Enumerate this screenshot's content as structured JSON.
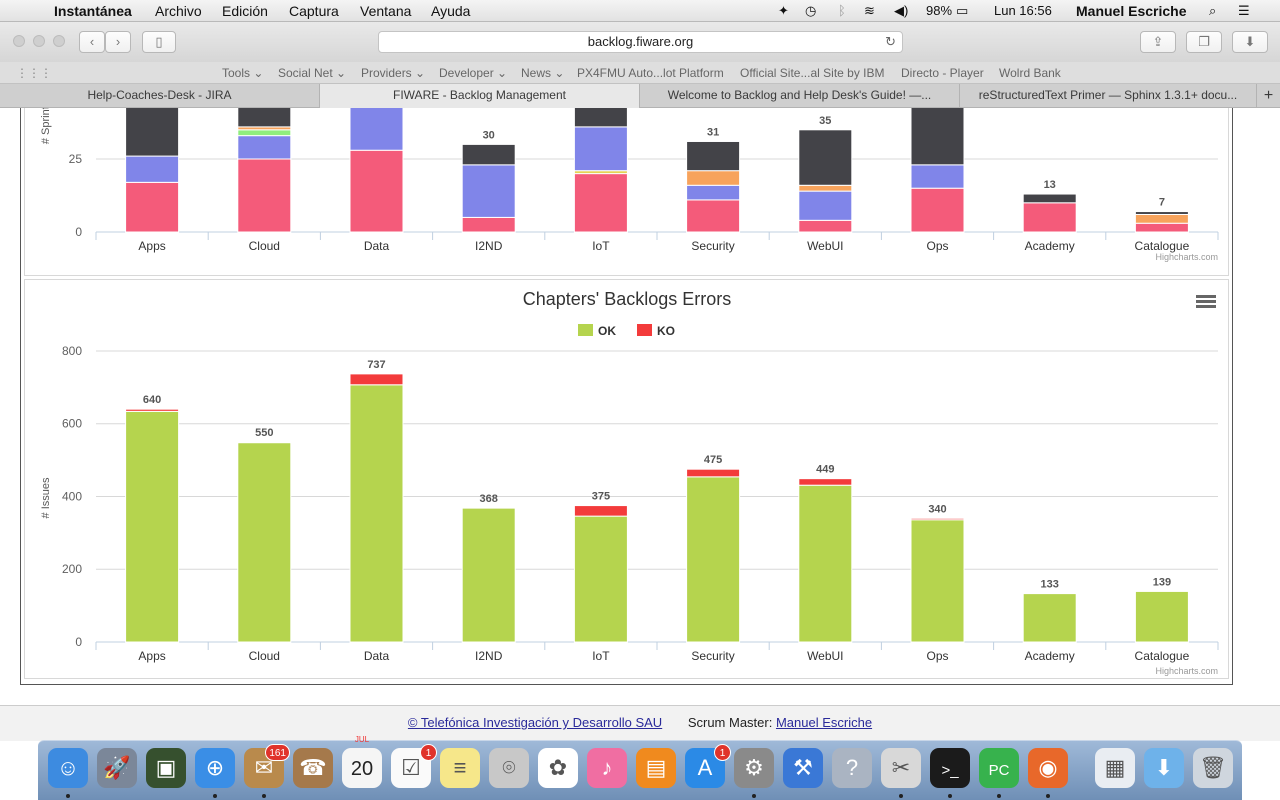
{
  "menubar": {
    "app": "Instantánea",
    "items": [
      "Archivo",
      "Edición",
      "Captura",
      "Ventana",
      "Ayuda"
    ],
    "battery": "98%",
    "clock": "Lun 16:56",
    "user": "Manuel Escriche"
  },
  "browser": {
    "url": "backlog.fiware.org",
    "favorites": [
      "Tools",
      "Social Net",
      "Providers",
      "Developer",
      "News",
      "PX4FMU Auto...lot Platform",
      "Official Site...al Site by IBM",
      "Directo - Player",
      "Wolrd Bank"
    ],
    "tabs": [
      "Help-Coaches-Desk - JIRA",
      "FIWARE - Backlog Management",
      "Welcome to Backlog and Help Desk's Guide! —...",
      "reStructuredText Primer — Sphinx 1.3.1+ docu..."
    ],
    "active_tab": 1
  },
  "colors": {
    "dark": "#434348",
    "blue": "#8085e9",
    "pink": "#f45b7a",
    "orange": "#f7a35c",
    "green": "#90ed7d",
    "lime": "#b5d44e",
    "koRed": "#f33b3b",
    "yellowish": "#e4d354"
  },
  "chart_data": [
    {
      "type": "bar",
      "stacked": true,
      "title": "",
      "ylabel": "# Sprint B",
      "visible_yticks": [
        0,
        25
      ],
      "categories": [
        "Apps",
        "Cloud",
        "Data",
        "I2ND",
        "IoT",
        "Security",
        "WebUI",
        "Ops",
        "Academy",
        "Catalogue"
      ],
      "totals": [
        "",
        "",
        "",
        "30",
        "",
        "31",
        "35",
        "",
        "13",
        "7"
      ],
      "series": [
        {
          "color": "#f45b7a",
          "values": [
            17,
            25,
            28,
            5,
            20,
            11,
            4,
            15,
            10,
            3
          ]
        },
        {
          "color": "#e4d354",
          "values": [
            0,
            0,
            0,
            0,
            1,
            0,
            0,
            0,
            0,
            0
          ]
        },
        {
          "color": "#8085e9",
          "values": [
            9,
            8,
            22,
            18,
            15,
            5,
            10,
            8,
            0,
            0
          ]
        },
        {
          "color": "#90ed7d",
          "values": [
            0,
            2,
            0,
            0,
            0,
            0,
            0,
            0,
            0,
            0
          ]
        },
        {
          "color": "#f7a35c",
          "values": [
            0,
            1,
            0,
            0,
            0,
            5,
            2,
            0,
            0,
            3
          ]
        },
        {
          "color": "#434348",
          "values": [
            19,
            10,
            0,
            7,
            7,
            10,
            19,
            22,
            3,
            1
          ]
        }
      ],
      "credit": "Highcharts.com"
    },
    {
      "type": "bar",
      "stacked": true,
      "title": "Chapters' Backlogs Errors",
      "ylabel": "# Issues",
      "ylim": [
        0,
        800
      ],
      "yticks": [
        0,
        200,
        400,
        600,
        800
      ],
      "categories": [
        "Apps",
        "Cloud",
        "Data",
        "I2ND",
        "IoT",
        "Security",
        "WebUI",
        "Ops",
        "Academy",
        "Catalogue"
      ],
      "totals": [
        "640",
        "550",
        "737",
        "368",
        "375",
        "475",
        "449",
        "340",
        "133",
        "139"
      ],
      "series": [
        {
          "name": "OK",
          "color": "#b5d44e",
          "values": [
            634,
            548,
            707,
            368,
            346,
            454,
            431,
            336,
            133,
            139
          ]
        },
        {
          "name": "KO",
          "color": "#f33b3b",
          "values": [
            6,
            2,
            30,
            0,
            29,
            21,
            18,
            4,
            0,
            0
          ]
        }
      ],
      "credit": "Highcharts.com"
    }
  ],
  "footer": {
    "company": "© Telefónica Investigación y Desarrollo SAU",
    "role": "Scrum Master:",
    "name": "Manuel Escriche"
  },
  "dock": [
    "finder-icon",
    "launchpad-icon",
    "preview-icon",
    "safari-icon",
    "mail-icon",
    "contacts-icon",
    "calendar-icon",
    "reminders-icon",
    "notes-icon",
    "photo-booth-icon",
    "photos-icon",
    "itunes-icon",
    "ibooks-icon",
    "app-store-icon",
    "system-preferences-icon",
    "xcode-icon",
    "help-icon",
    "screenshot-icon",
    "terminal-icon",
    "pycharm-icon",
    "firefox-icon",
    "documents-stack-icon",
    "downloads-stack-icon",
    "trash-icon"
  ],
  "dock_badges": {
    "mail": "161",
    "calendar_day": "20",
    "calendar_month": "JUL",
    "reminders": "1",
    "app_store": "1"
  }
}
